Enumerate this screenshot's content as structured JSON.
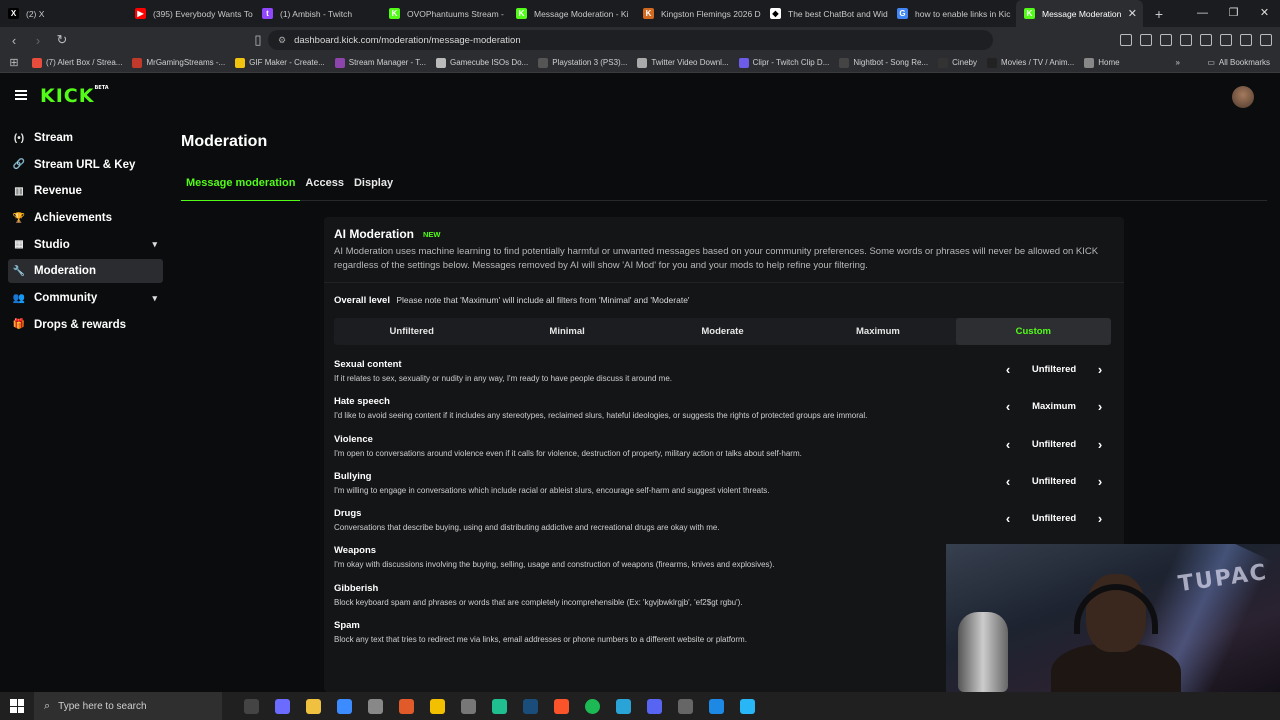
{
  "browser": {
    "tabs": [
      {
        "label": "(2) X",
        "color": "#000000",
        "glyph": "X"
      },
      {
        "label": "(395) Everybody Wants To",
        "color": "#ff0000",
        "glyph": "▶"
      },
      {
        "label": "(1) Ambish - Twitch",
        "color": "#9146ff",
        "glyph": "t"
      },
      {
        "label": "OVOPhantuums Stream -",
        "color": "#53fc18",
        "glyph": "K"
      },
      {
        "label": "Message Moderation - Ki",
        "color": "#53fc18",
        "glyph": "K"
      },
      {
        "label": "Kingston Flemings 2026 D",
        "color": "#d2691e",
        "glyph": "K"
      },
      {
        "label": "The best ChatBot and Wid",
        "color": "#ffffff",
        "glyph": "◆"
      },
      {
        "label": "how to enable links in Kic",
        "color": "#4285f4",
        "glyph": "G"
      },
      {
        "label": "Message Moderation",
        "color": "#53fc18",
        "glyph": "K"
      }
    ],
    "url": "dashboard.kick.com/moderation/message-moderation",
    "bookmarks": [
      "(7) Alert Box / Strea...",
      "MrGamingStreams -...",
      "GIF Maker - Create...",
      "Stream Manager - T...",
      "Gamecube ISOs Do...",
      "Playstation 3 (PS3)...",
      "Twitter Video Downl...",
      "Clipr - Twitch Clip D...",
      "Nightbot - Song Re...",
      "Cineby",
      "Movies / TV / Anim...",
      "Home"
    ],
    "all_bookmarks": "All Bookmarks"
  },
  "app": {
    "logo": "KICK",
    "logo_sup": "BETA"
  },
  "sidebar": {
    "items": [
      {
        "label": "Stream",
        "icon": "(•)"
      },
      {
        "label": "Stream URL & Key",
        "icon": "🔗"
      },
      {
        "label": "Revenue",
        "icon": "▥"
      },
      {
        "label": "Achievements",
        "icon": "🏆"
      },
      {
        "label": "Studio",
        "icon": "▦",
        "chevron": "▾"
      },
      {
        "label": "Moderation",
        "icon": "🔧"
      },
      {
        "label": "Community",
        "icon": "👥",
        "chevron": "▾"
      },
      {
        "label": "Drops & rewards",
        "icon": "🎁"
      }
    ]
  },
  "main": {
    "title": "Moderation",
    "tabs": [
      "Message moderation",
      "Access",
      "Display"
    ],
    "ai": {
      "title": "AI Moderation",
      "badge": "NEW",
      "description": "AI Moderation uses machine learning to find potentially harmful or unwanted messages based on your community preferences. Some words or phrases will never be allowed on KICK regardless of the settings below. Messages removed by AI will show 'AI Mod' for you and your mods to help refine your filtering."
    },
    "overall": {
      "label": "Overall level",
      "note": "Please note that 'Maximum' will include all filters from 'Minimal' and 'Moderate'",
      "levels": [
        "Unfiltered",
        "Minimal",
        "Moderate",
        "Maximum",
        "Custom"
      ],
      "selected": "Custom"
    },
    "categories": [
      {
        "name": "Sexual content",
        "desc": "If it relates to sex, sexuality or nudity in any way, I'm ready to have people discuss it around me.",
        "value": "Unfiltered"
      },
      {
        "name": "Hate speech",
        "desc": "I'd like to avoid seeing content if it includes any stereotypes, reclaimed slurs, hateful ideologies, or suggests the rights of protected groups are immoral.",
        "value": "Maximum"
      },
      {
        "name": "Violence",
        "desc": "I'm open to conversations around violence even if it calls for violence, destruction of property, military action or talks about self-harm.",
        "value": "Unfiltered"
      },
      {
        "name": "Bullying",
        "desc": "I'm willing to engage in conversations which include racial or ableist slurs, encourage self-harm and suggest violent threats.",
        "value": "Unfiltered"
      },
      {
        "name": "Drugs",
        "desc": "Conversations that describe buying, using and distributing addictive and recreational drugs are okay with me.",
        "value": "Unfiltered"
      },
      {
        "name": "Weapons",
        "desc": "I'm okay with discussions involving the buying, selling, usage and construction of weapons (firearms, knives and explosives).",
        "value": ""
      },
      {
        "name": "Gibberish",
        "desc": "Block keyboard spam and phrases or words that are completely incomprehensible (Ex: 'kgvjbwklrgjb', 'ef2$gt rgbu').",
        "value": ""
      },
      {
        "name": "Spam",
        "desc": "Block any text that tries to redirect me via links, email addresses or phone numbers to a different website or platform.",
        "value": ""
      }
    ]
  },
  "webcam": {
    "sign": "TUPAC"
  },
  "taskbar": {
    "search_placeholder": "Type here to search"
  },
  "colors": {
    "accent": "#53fc18",
    "background": "#0b0c0d",
    "panel": "#141517"
  }
}
